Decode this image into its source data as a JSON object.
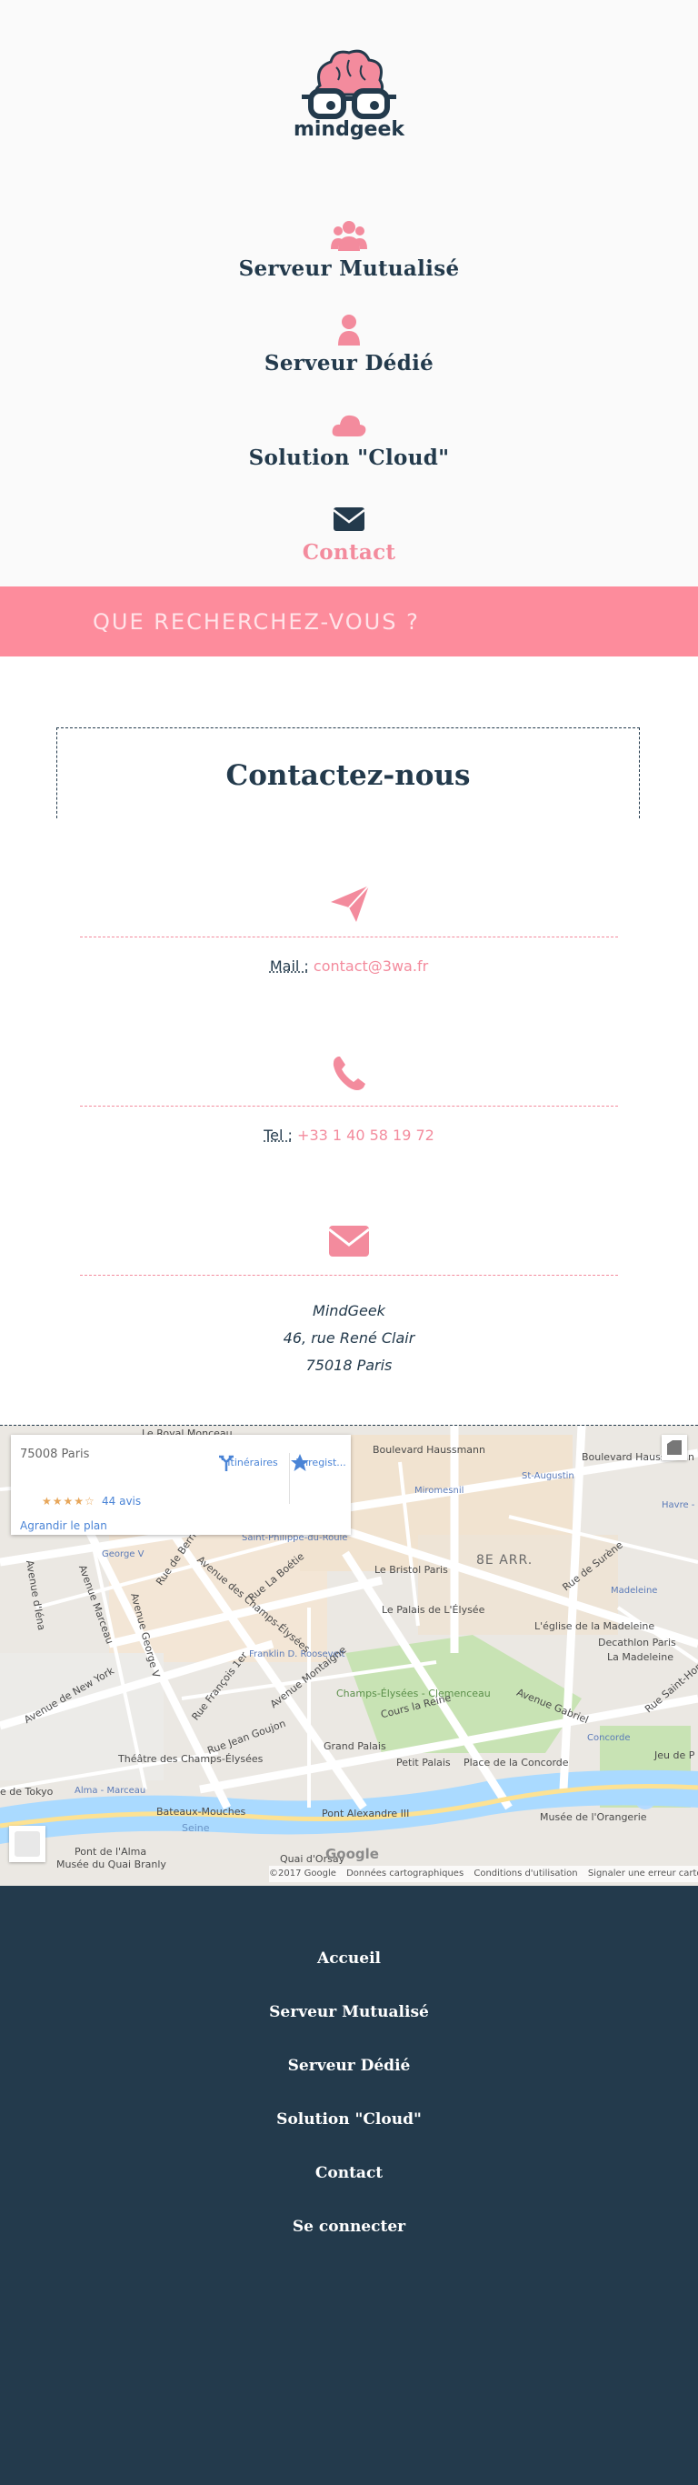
{
  "brand": {
    "name": "mindgeek",
    "colors": {
      "primary": "#233a4c",
      "accent": "#f38b9d",
      "band": "#fd8c9c"
    }
  },
  "nav": {
    "items": [
      {
        "label": "Serveur Mutualisé",
        "icon": "users-icon"
      },
      {
        "label": "Serveur Dédié",
        "icon": "user-icon"
      },
      {
        "label": "Solution \"Cloud\"",
        "icon": "cloud-icon"
      },
      {
        "label": "Contact",
        "icon": "envelope-icon",
        "active": true
      }
    ]
  },
  "search": {
    "placeholder": "QUE RECHERCHEZ-VOUS ?"
  },
  "contact": {
    "title": "Contactez-nous",
    "mail_label": "Mail :",
    "mail_value": "contact@3wa.fr",
    "tel_label": "Tel :",
    "tel_value": "+33 1 40 58 19 72",
    "address": {
      "name": "MindGeek",
      "street": "46, rue René Clair",
      "city": "75018 Paris"
    }
  },
  "map": {
    "card": {
      "address": "75008 Paris",
      "rating_stars": "★★★★☆",
      "reviews": "44 avis",
      "directions": "Itinéraires",
      "save": "Enregist...",
      "enlarge": "Agrandir le plan"
    },
    "labels": {
      "royal_monceau": "Le Royal Monceau",
      "bd_haussmann": "Boulevard Haussmann",
      "bd_haussmann2": "Boulevard Haussmann",
      "miromesnil": "Miromesnil",
      "st_augustin": "St-Augustin",
      "havre": "Havre -",
      "george_v": "George V",
      "st_philippe": "Saint-Philippe-du-Roule",
      "bristol": "Le Bristol Paris",
      "arr8": "8E ARR.",
      "madeleine": "Madeleine",
      "palais_elysee": "Le Palais de L'Élysée",
      "eglise_madeleine": "L'église de la Madeleine",
      "decathlon": "Decathlon Paris",
      "la_madeleine": "La Madeleine",
      "franklin": "Franklin D. Roosevelt",
      "champs_clem": "Champs-Élysées - Clemenceau",
      "concorde": "Concorde",
      "jeu_paume": "Jeu de P",
      "theatre": "Théâtre des Champs-Élysées",
      "grand_palais": "Grand Palais",
      "petit_palais": "Petit Palais",
      "place_concorde": "Place de la Concorde",
      "tokyo": "e de Tokyo",
      "alma": "Alma - Marceau",
      "bateaux": "Bateaux-Mouches",
      "pont_alex": "Pont Alexandre III",
      "orangerie": "Musée de l'Orangerie",
      "seine": "Seine",
      "pont_alma": "Pont de l'Alma",
      "quai_branly": "Musée du Quai Branly",
      "quai_orsay": "Quai d'Orsay",
      "av_champs": "Avenue des Champs-Élysées",
      "rue_berri": "Rue de Berri",
      "av_marceau": "Avenue Marceau",
      "rue_boetie": "Rue La Boétie",
      "av_montaigne": "Avenue Montaigne",
      "rue_francois": "Rue François 1er",
      "rue_jean_goujon": "Rue Jean Goujon",
      "av_gabriel": "Avenue Gabriel",
      "rue_surene": "Rue de Surène",
      "rue_st_honore": "Rue Saint-Honoré",
      "cours_reine": "Cours la Reine",
      "av_george_v": "Avenue George V",
      "av_iena": "Avenue d'Iéna",
      "av_new_york": "Avenue de New York"
    },
    "footer": {
      "google": "Google",
      "copyright": "©2017 Google",
      "data": "Données cartographiques",
      "terms": "Conditions d'utilisation",
      "report": "Signaler une erreur cartographique"
    }
  },
  "footer": {
    "links": [
      "Accueil",
      "Serveur Mutualisé",
      "Serveur Dédié",
      "Solution \"Cloud\"",
      "Contact",
      "Se connecter"
    ]
  }
}
